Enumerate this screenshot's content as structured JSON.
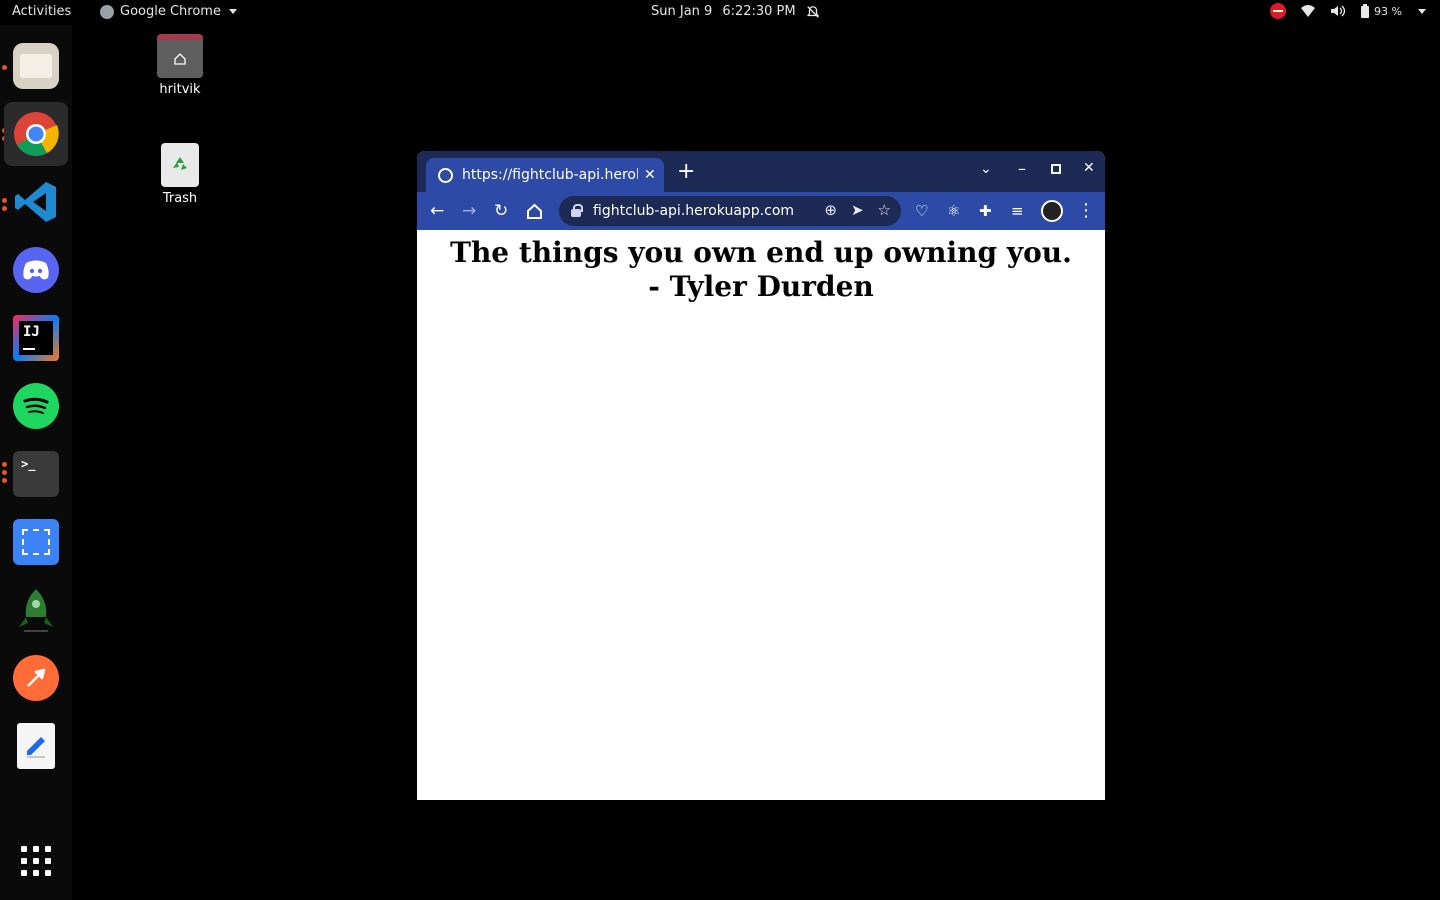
{
  "topbar": {
    "activities": "Activities",
    "app_name": "Google Chrome",
    "date": "Sun Jan 9",
    "time": "6:22:30 PM",
    "battery": "93 %"
  },
  "desktop": {
    "home_label": "hritvik",
    "trash_label": "Trash"
  },
  "dock": {
    "apps": [
      "Files",
      "Google Chrome",
      "Visual Studio Code",
      "Discord",
      "IntelliJ IDEA",
      "Spotify",
      "Terminal",
      "Screenshot",
      "Rocket",
      "Postman",
      "Text Editor",
      "Show Applications"
    ]
  },
  "browser": {
    "tab_title": "https://fightclub-api.herokuapp.com",
    "url": "fightclub-api.herokuapp.com",
    "page_text": "The things you own end up owning you. - Tyler Durden"
  },
  "colors": {
    "tabstrip": "#1c2a55",
    "toolbar": "#2d4aa6",
    "accent": "#e95420"
  }
}
